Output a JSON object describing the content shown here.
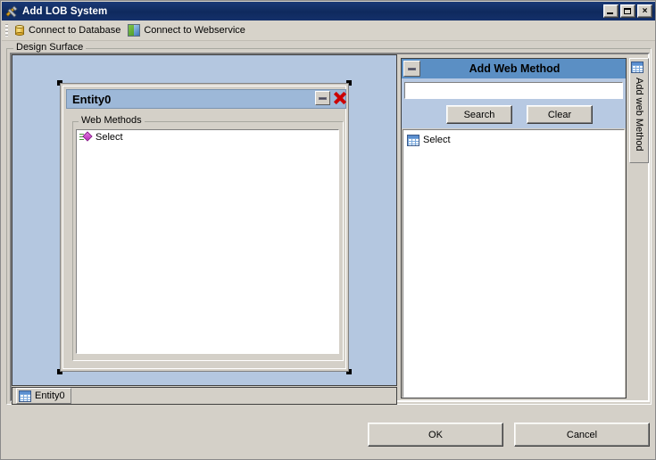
{
  "window": {
    "title": "Add LOB System",
    "icon": "tools-icon",
    "controls": {
      "minimize": "minimize-icon",
      "maximize": "maximize-icon",
      "close": "×"
    }
  },
  "toolbar": {
    "items": [
      {
        "label": "Connect to Database",
        "icon": "database-icon"
      },
      {
        "label": "Connect to Webservice",
        "icon": "webservice-icon"
      }
    ]
  },
  "design_surface": {
    "legend": "Design Surface",
    "canvas_color": "#b4c7e0",
    "entity": {
      "title": "Entity0",
      "minimize_label": "minimize-icon",
      "close_label": "close-icon",
      "group_legend": "Web Methods",
      "methods": [
        {
          "label": "Select",
          "icon": "method-diamond-icon"
        }
      ]
    },
    "tabstrip": {
      "tabs": [
        {
          "label": "Entity0",
          "icon": "grid-icon"
        }
      ]
    }
  },
  "add_web_method": {
    "title": "Add Web Method",
    "minimize_label": "minimize-icon",
    "search": {
      "value": "",
      "placeholder": ""
    },
    "buttons": {
      "search": "Search",
      "clear": "Clear"
    },
    "results": [
      {
        "label": "Select",
        "icon": "grid-icon"
      }
    ],
    "vertical_tab": {
      "label": "Add web Method",
      "icon": "grid-icon"
    }
  },
  "footer": {
    "ok": "OK",
    "cancel": "Cancel"
  },
  "colors": {
    "titlebar": "#14306a",
    "canvas": "#b4c7e0",
    "panel_header": "#5b8fc4",
    "entity_header": "#9db8d8",
    "dialog_face": "#d4d0c8",
    "close_red": "#cc0000"
  }
}
